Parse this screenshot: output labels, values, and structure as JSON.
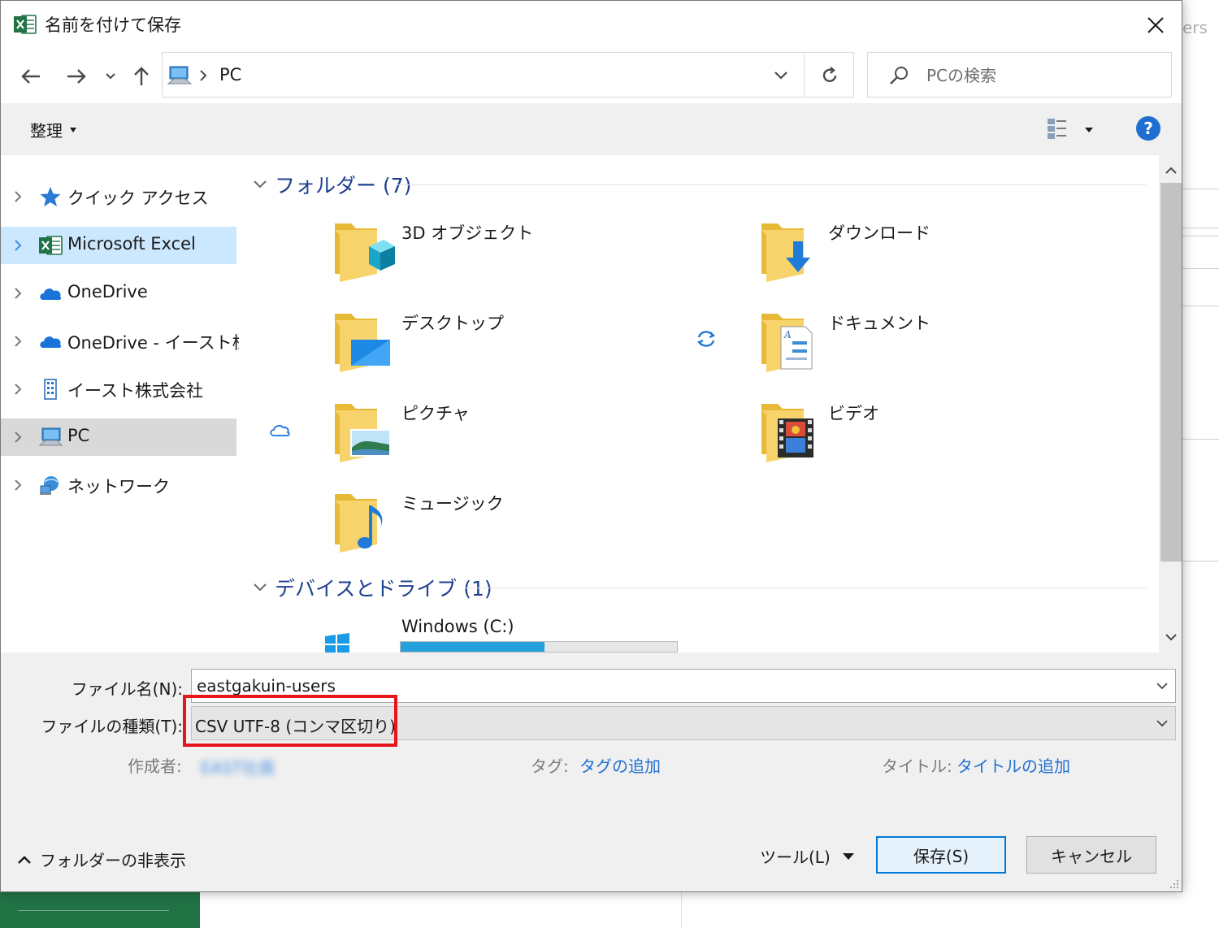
{
  "background": {
    "partial_text": "ers"
  },
  "dialog": {
    "title": "名前を付けて保存",
    "app_icon": "excel-icon",
    "colors": {
      "accent": "#0078d7",
      "link": "#1f6fd1",
      "group_header": "#1e3f8f",
      "excel_green": "#217346",
      "highlight": "#e8141b"
    }
  },
  "nav": {
    "address": {
      "segments": [
        "PC"
      ]
    },
    "search_placeholder": "PCの検索"
  },
  "toolbar": {
    "organize_label": "整理",
    "help_label": "?"
  },
  "sidebar": {
    "items": [
      {
        "label": "クイック アクセス",
        "icon": "star-icon"
      },
      {
        "label": "Microsoft Excel",
        "icon": "excel-icon"
      },
      {
        "label": "OneDrive",
        "icon": "cloud-icon"
      },
      {
        "label": "OneDrive - イースト株式会社",
        "icon": "cloud-icon"
      },
      {
        "label": "イースト株式会社",
        "icon": "building-icon"
      },
      {
        "label": "PC",
        "icon": "pc-icon"
      },
      {
        "label": "ネットワーク",
        "icon": "network-icon"
      }
    ]
  },
  "content": {
    "groups": [
      {
        "label": "フォルダー (7)"
      },
      {
        "label": "デバイスとドライブ (1)"
      }
    ],
    "folders": [
      {
        "label": "3D オブジェクト",
        "icon": "3d-objects-folder-icon"
      },
      {
        "label": "ダウンロード",
        "icon": "downloads-folder-icon"
      },
      {
        "label": "デスクトップ",
        "icon": "desktop-folder-icon"
      },
      {
        "label": "ドキュメント",
        "icon": "documents-folder-icon",
        "status": "sync-icon"
      },
      {
        "label": "ピクチャ",
        "icon": "pictures-folder-icon",
        "status": "cloud-outline-icon"
      },
      {
        "label": "ビデオ",
        "icon": "videos-folder-icon"
      },
      {
        "label": "ミュージック",
        "icon": "music-folder-icon"
      }
    ],
    "drives": [
      {
        "label": "Windows  (C:)",
        "icon": "windows-drive-icon",
        "usage": 0.52
      }
    ]
  },
  "form": {
    "filename_label": "ファイル名(N):",
    "filename_value": "eastgakuin-users",
    "filetype_label": "ファイルの種類(T):",
    "filetype_value": "CSV UTF-8 (コンマ区切り)",
    "author_label": "作成者:",
    "author_value": "EAST社員",
    "tags_label": "タグ:",
    "tags_link": "タグの追加",
    "title_label": "タイトル:",
    "title_link": "タイトルの追加",
    "hide_folders": "フォルダーの非表示",
    "tools": "ツール(L)",
    "save": "保存(S)",
    "cancel": "キャンセル"
  }
}
